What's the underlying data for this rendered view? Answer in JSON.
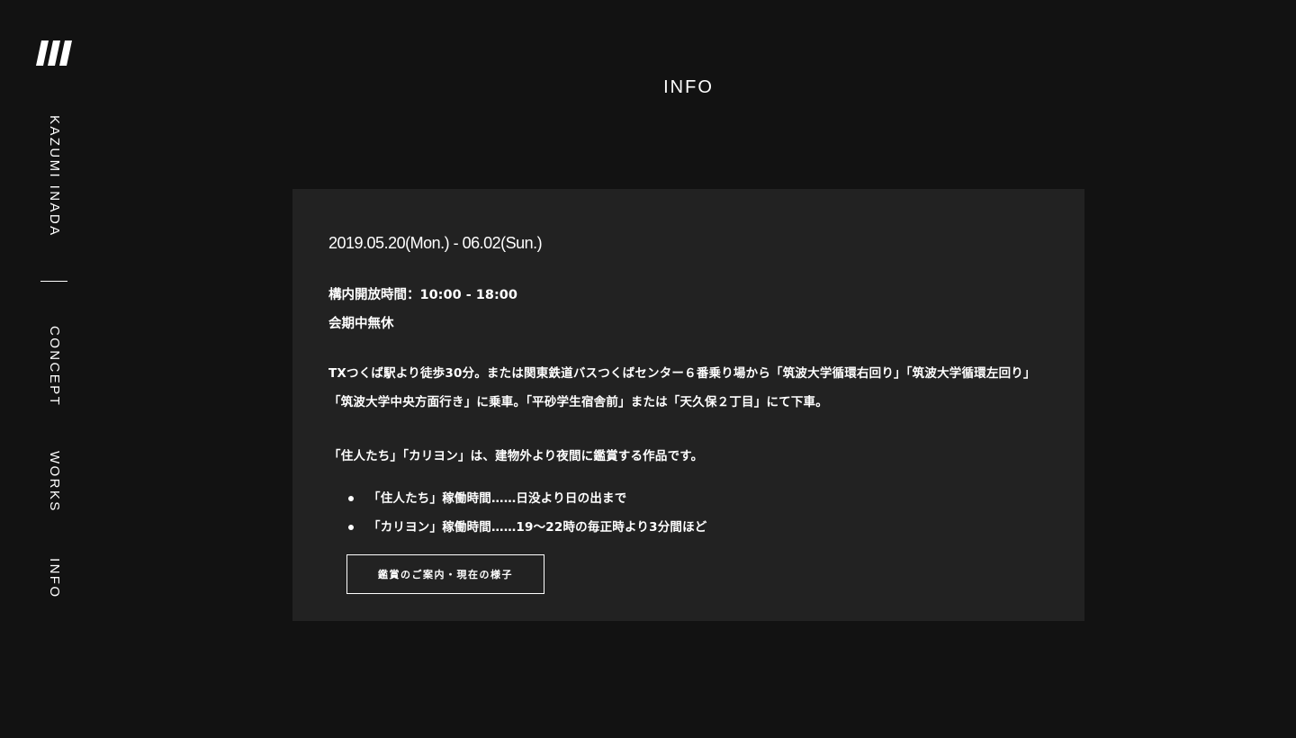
{
  "sidebar": {
    "logo_icon": "slanted-bars-logo",
    "artist_name": "KAZUMI INADA",
    "nav": {
      "concept": "CONCEPT",
      "works": "WORKS",
      "info": "INFO"
    }
  },
  "main": {
    "title": "INFO",
    "card": {
      "date": "2019.05.20(Mon.) - 06.02(Sun.)",
      "hours": "構内開放時間：10:00 - 18:00",
      "closed_note": "会期中無休",
      "access": "TXつくば駅より徒歩30分。または関東鉄道バスつくばセンター６番乗り場から「筑波大学循環右回り」「筑波大学循環左回り」「筑波大学中央方面行き」に乗車。「平砂学生宿舎前」または「天久保２丁目」にて下車。",
      "night_note": "「住人たち」「カリヨン」は、建物外より夜間に鑑賞する作品です。",
      "schedule": [
        "「住人たち」稼働時間……日没より日の出まで",
        "「カリヨン」稼働時間……19〜22時の毎正時より3分間ほど"
      ],
      "button_label": "鑑賞のご案内・現在の様子"
    }
  },
  "colors": {
    "background": "#121212",
    "card": "#222222",
    "text": "#ffffff"
  }
}
